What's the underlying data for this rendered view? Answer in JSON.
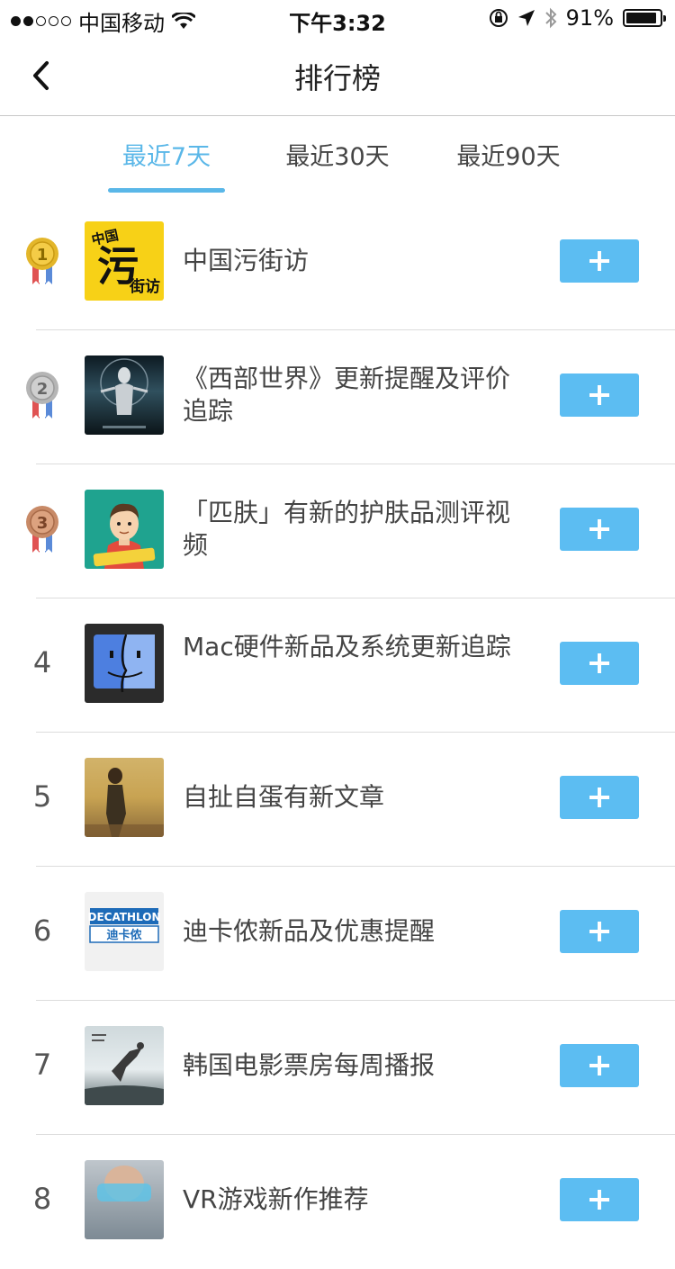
{
  "status_bar": {
    "carrier": "中国移动",
    "time": "下午3:32",
    "battery": "91%",
    "battery_level": 0.91,
    "signal_dots": [
      true,
      true,
      false,
      false,
      false
    ]
  },
  "nav": {
    "title": "排行榜",
    "back_icon": "chevron-left-icon"
  },
  "tabs": [
    {
      "label": "最近7天",
      "active": true
    },
    {
      "label": "最近30天",
      "active": false
    },
    {
      "label": "最近90天",
      "active": false
    }
  ],
  "colors": {
    "accent": "#5ab7e8",
    "button": "#5cbdf2",
    "gold": "#e3b62a",
    "silver": "#b5b5b5",
    "bronze": "#c88a67"
  },
  "items": [
    {
      "rank": "1",
      "medal": "gold",
      "name": "中国污街访",
      "thumb": "zhongguo-wujiefang-logo"
    },
    {
      "rank": "2",
      "medal": "silver",
      "name": "《西部世界》更新提醒及评价追踪",
      "thumb": "westworld-poster"
    },
    {
      "rank": "3",
      "medal": "bronze",
      "name": "「匹肤」有新的护肤品测评视频",
      "thumb": "pifu-cartoon-avatar"
    },
    {
      "rank": "4",
      "medal": null,
      "name": "Mac硬件新品及系统更新追踪",
      "thumb": "mac-finder-icon"
    },
    {
      "rank": "5",
      "medal": null,
      "name": "自扯自蛋有新文章",
      "thumb": "painting-thumbnail"
    },
    {
      "rank": "6",
      "medal": null,
      "name": "迪卡侬新品及优惠提醒",
      "thumb": "decathlon-logo"
    },
    {
      "rank": "7",
      "medal": null,
      "name": "韩国电影票房每周播报",
      "thumb": "movie-poster-thumbnail"
    },
    {
      "rank": "8",
      "medal": null,
      "name": "VR游戏新作推荐",
      "thumb": "vr-headset-thumbnail"
    }
  ],
  "add_button_icon": "plus-icon",
  "decathlon": {
    "brand": "DECATHLON",
    "cn": "迪卡侬"
  },
  "wujiefang": {
    "top": "中国",
    "big": "污",
    "side": "街访"
  }
}
